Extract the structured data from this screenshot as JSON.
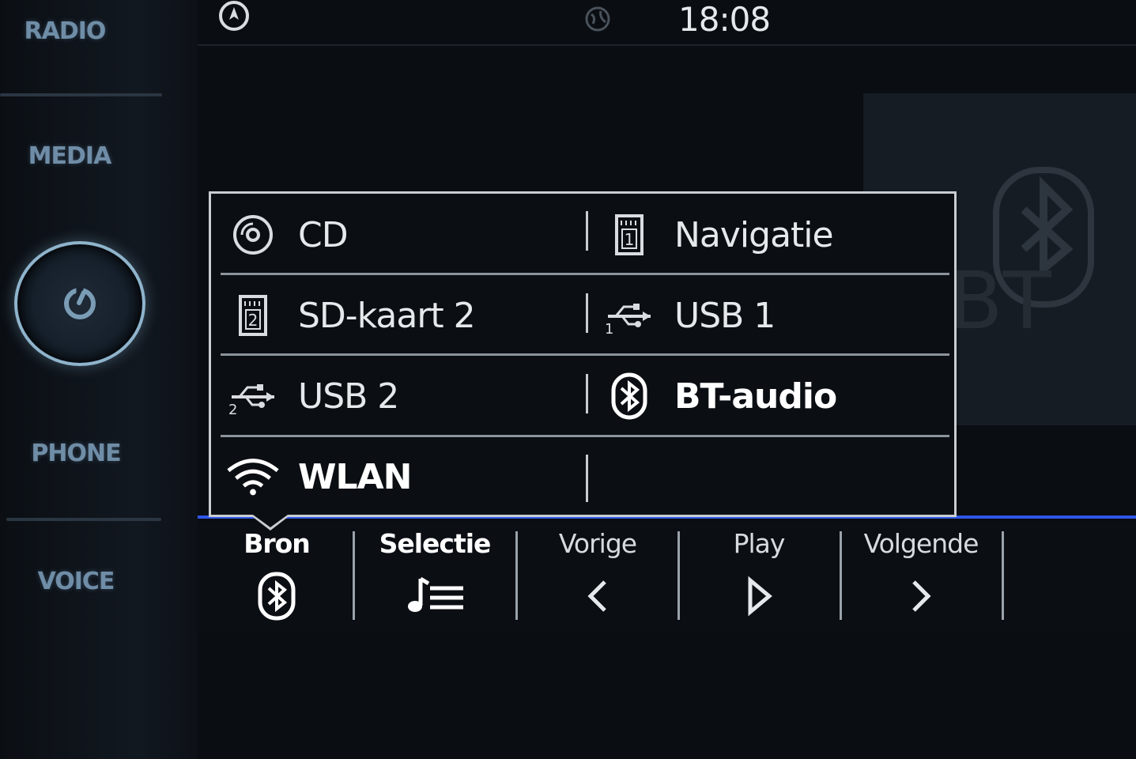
{
  "hardware_buttons": {
    "radio": "RADIO",
    "media": "MEDIA",
    "phone": "PHONE",
    "voice": "VOICE"
  },
  "status_bar": {
    "time": "18:08"
  },
  "source_menu": {
    "items": [
      {
        "label": "CD",
        "icon": "cd-icon"
      },
      {
        "label": "Navigatie",
        "icon": "sd-card-1-icon"
      },
      {
        "label": "SD-kaart 2",
        "icon": "sd-card-2-icon"
      },
      {
        "label": "USB 1",
        "icon": "usb-1-icon"
      },
      {
        "label": "USB 2",
        "icon": "usb-2-icon"
      },
      {
        "label": "BT-audio",
        "icon": "bluetooth-icon",
        "selected": true
      },
      {
        "label": "WLAN",
        "icon": "wifi-icon"
      }
    ]
  },
  "bottom_bar": {
    "bron": "Bron",
    "selectie": "Selectie",
    "vorige": "Vorige",
    "play": "Play",
    "volgende": "Volgende"
  },
  "colors": {
    "accent_line": "#2f56e8",
    "hardware_label": "#6f8da6",
    "popup_border": "#c9cdd1"
  }
}
